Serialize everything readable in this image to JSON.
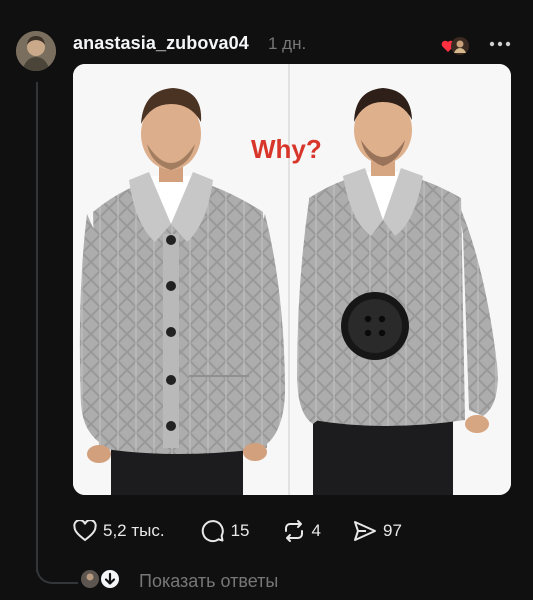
{
  "post": {
    "username": "anastasia_zubova04",
    "time": "1 дн.",
    "image_caption": "Why?",
    "stats": {
      "likes": "5,2 тыс.",
      "comments": "15",
      "reposts": "4",
      "shares": "97"
    },
    "show_replies": "Показать ответы"
  },
  "colors": {
    "background": "#101010",
    "text": "#f3f5f7",
    "muted": "#777777",
    "caption_red": "#d9362b",
    "sweater": "#a9a9a9"
  },
  "icons": [
    "avatar",
    "heart-badge-icon",
    "more-icon",
    "heart-icon",
    "comment-icon",
    "repost-icon",
    "share-icon",
    "download-icon"
  ]
}
